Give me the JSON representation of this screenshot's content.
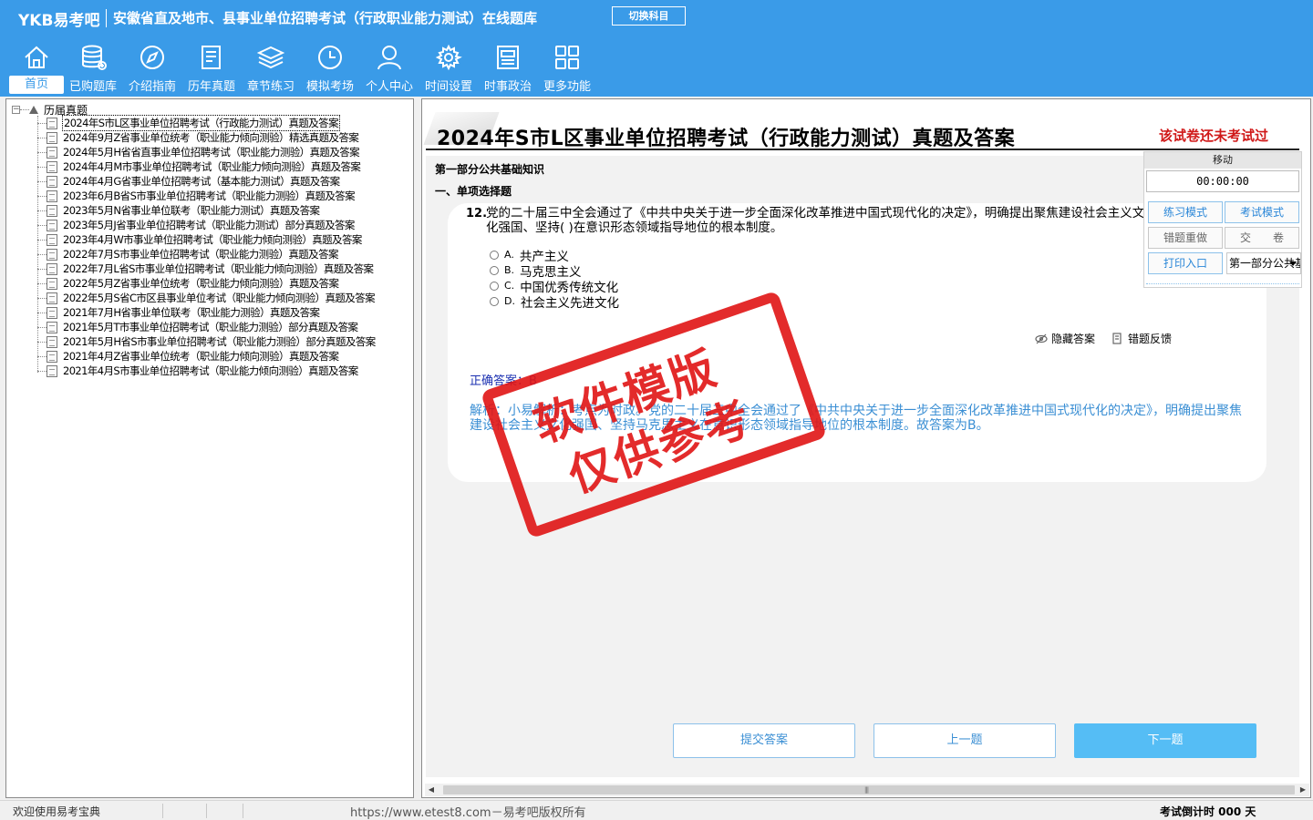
{
  "header": {
    "logo": "YKB易考吧",
    "title": "安徽省直及地市、县事业单位招聘考试（行政职业能力测试）在线题库",
    "switch_button": "切换科目",
    "nav": [
      {
        "label": "首页",
        "icon": "home-icon",
        "active": true
      },
      {
        "label": "已购题库",
        "icon": "database-icon"
      },
      {
        "label": "介绍指南",
        "icon": "compass-icon"
      },
      {
        "label": "历年真题",
        "icon": "document-list-icon"
      },
      {
        "label": "章节练习",
        "icon": "layers-icon"
      },
      {
        "label": "模拟考场",
        "icon": "clock-icon"
      },
      {
        "label": "个人中心",
        "icon": "user-icon"
      },
      {
        "label": "时间设置",
        "icon": "gear-icon"
      },
      {
        "label": "时事政治",
        "icon": "newspaper-icon"
      },
      {
        "label": "更多功能",
        "icon": "grid-icon"
      }
    ]
  },
  "tree": {
    "root": "历届真题",
    "items": [
      "2024年S市L区事业单位招聘考试（行政能力测试）真题及答案",
      "2024年9月Z省事业单位统考（职业能力倾向测验）精选真题及答案",
      "2024年5月H省省直事业单位招聘考试（职业能力测验）真题及答案",
      "2024年4月M市事业单位招聘考试（职业能力倾向测验）真题及答案",
      "2024年4月G省事业单位招聘考试（基本能力测试）真题及答案",
      "2023年6月B省S市事业单位招聘考试（职业能力测验）真题及答案",
      "2023年5月N省事业单位联考（职业能力测试）真题及答案",
      "2023年5月J省事业单位招聘考试（职业能力测试）部分真题及答案",
      "2023年4月W市事业单位招聘考试（职业能力倾向测验）真题及答案",
      "2022年7月S市事业单位招聘考试（职业能力测验）真题及答案",
      "2022年7月L省S市事业单位招聘考试（职业能力倾向测验）真题及答案",
      "2022年5月Z省事业单位统考（职业能力倾向测验）真题及答案",
      "2022年5月S省C市区县事业单位考试（职业能力倾向测验）真题及答案",
      "2021年7月H省事业单位联考（职业能力测验）真题及答案",
      "2021年5月T市事业单位招聘考试（职业能力测验）部分真题及答案",
      "2021年5月H省S市事业单位招聘考试（职业能力测验）部分真题及答案",
      "2021年4月Z省事业单位统考（职业能力倾向测验）真题及答案",
      "2021年4月S市事业单位招聘考试（职业能力倾向测验）真题及答案"
    ]
  },
  "exam": {
    "title": "2024年S市L区事业单位招聘考试（行政能力测试）真题及答案",
    "status": "该试卷还未考试过",
    "section": "第一部分公共基础知识",
    "subsection": "一、单项选择题",
    "question": {
      "number": "12.",
      "text": "党的二十届三中全会通过了《中共中央关于进一步全面深化改革推进中国式现代化的决定》，明确提出聚焦建设社会主义文化强国、坚持(    )在意识形态领域指导地位的根本制度。",
      "options": [
        {
          "key": "A.",
          "text": "共产主义"
        },
        {
          "key": "B.",
          "text": "马克思主义"
        },
        {
          "key": "C.",
          "text": "中国优秀传统文化"
        },
        {
          "key": "D.",
          "text": "社会主义先进文化"
        }
      ]
    },
    "hide_answer": "隐藏答案",
    "feedback": "错题反馈",
    "answer": "正确答案：B",
    "analysis": "解析：小易解析：考点为时政。党的二十届三中全会通过了《中共中央关于进一步全面深化改革推进中国式现代化的决定》，明确提出聚焦建设社会主义文化强国、坚持马克思主义在意识形态领域指导地位的根本制度。故答案为B。"
  },
  "control": {
    "move": "移动",
    "timer": "00:00:00",
    "practice_mode": "练习模式",
    "exam_mode": "考试模式",
    "redo_wrong": "错题重做",
    "submit_paper": "交　　卷",
    "print": "打印入口",
    "part_select": "第一部分公共基础知识"
  },
  "buttons": {
    "submit_answer": "提交答案",
    "prev": "上一题",
    "next": "下一题"
  },
  "stamp": {
    "line1": "软件模版",
    "line2": "仅供参考"
  },
  "statusbar": {
    "welcome": "欢迎使用易考宝典",
    "copyright": "https://www.etest8.com－易考吧版权所有",
    "countdown": "考试倒计时 000 天"
  },
  "colors": {
    "header_bg": "#3a9be8",
    "status_red": "#d01818",
    "stamp_red": "#e01515",
    "answer_blue": "#1a2fb0",
    "analysis_blue": "#3b8fd4",
    "next_button_bg": "#55bdf5"
  }
}
